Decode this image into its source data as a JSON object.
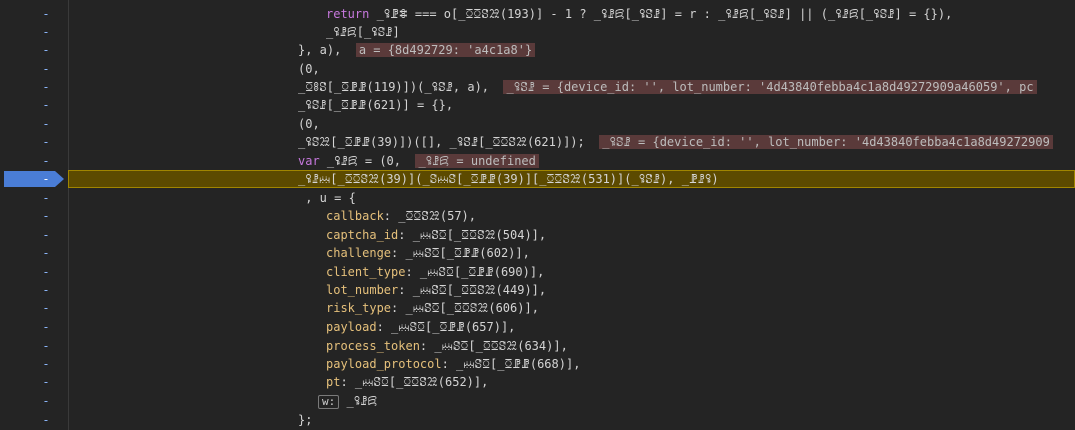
{
  "lines": [
    {
      "marker": "-",
      "code": "return _ꖤꗘꗵ === o[_ꗞꗞꗟꗠ(193)] - 1 ? _ꖤꗗꗛ[_ꖤꗟꗗ] = r : _ꖤꗗꗛ[_ꖤꗟꗗ] || (_ꖤꗗꗛ[_ꖤꗟꗗ] = {}),"
    },
    {
      "marker": "-",
      "code": "_ꖤꗗꗛ[_ꖤꗟꗗ]"
    },
    {
      "marker": "-",
      "code": "}, a),",
      "inline": "a = {8d492729: 'a4c1a8'}"
    },
    {
      "marker": "-",
      "code": "(0,"
    },
    {
      "marker": "-",
      "code": "_ꗞꗚꗟ[_ꗞꗘꗙ(119)])(_ꖤꗟꗗ, a),",
      "inline": "_ꖤꗟꗗ = {device_id: '', lot_number: '4d43840febba4c1a8d49272909a46059', pc"
    },
    {
      "marker": "-",
      "code": "_ꖤꗟꗗ[_ꗞꗘꗙ(621)] = {},"
    },
    {
      "marker": "-",
      "code": "(0,"
    },
    {
      "marker": "-",
      "code": "_ꖤꗟꗠ[_ꗞꗘꗙ(39)])([], _ꖤꗟꗗ[_ꗞꗞꗟꗠ(621)]);",
      "inline": "_ꖤꗟꗗ = {device_id: '', lot_number: '4d43840febba4c1a8d49272909"
    },
    {
      "marker": "-",
      "code": "var _ꖤꗗꗛ = (0,",
      "inline": "_ꖤꗗꗛ = undefined"
    },
    {
      "marker": "-",
      "code": "_ꖤꗗꗜ[_ꗞꗞꗟꗠ(39)](_ꗟꗜꗟ[_ꗞꗘꗙ(39)][_ꗞꗞꗟꗠ(531)](_ꖤꗟꗗ), _ꗘꗗꖤ)"
    },
    {
      "marker": "-",
      "code": " , u = {"
    },
    {
      "marker": "-",
      "prop": "callback",
      "code": ": _ꗞꗞꗟꗠ(57),"
    },
    {
      "marker": "-",
      "prop": "captcha_id",
      "code": ": _ꗜꗟꗞ[_ꗞꗞꗟꗠ(504)],"
    },
    {
      "marker": "-",
      "prop": "challenge",
      "code": ": _ꗜꗟꗞ[_ꗞꗘꗙ(602)],"
    },
    {
      "marker": "-",
      "prop": "client_type",
      "code": ": _ꗜꗟꗞ[_ꗞꗘꗙ(690)],"
    },
    {
      "marker": "-",
      "prop": "lot_number",
      "code": ": _ꗜꗟꗞ[_ꗞꗞꗟꗠ(449)],"
    },
    {
      "marker": "-",
      "prop": "risk_type",
      "code": ": _ꗜꗟꗞ[_ꗞꗞꗟꗠ(606)],"
    },
    {
      "marker": "-",
      "prop": "payload",
      "code": ": _ꗜꗟꗞ[_ꗞꗘꗙ(657)],"
    },
    {
      "marker": "-",
      "prop": "process_token",
      "code": ": _ꗜꗟꗞ[_ꗞꗞꗟꗠ(634)],"
    },
    {
      "marker": "-",
      "prop": "payload_protocol",
      "code": ": _ꗜꗟꗞ[_ꗞꗘꗙ(668)],"
    },
    {
      "marker": "-",
      "prop": "pt",
      "code": ": _ꗜꗟꗞ[_ꗞꗞꗟꗠ(652)],"
    },
    {
      "marker": "-",
      "badge": "w:",
      "code": "_ꖤꗗꗛ"
    },
    {
      "marker": "-",
      "code": "};"
    }
  ],
  "keywords": {
    "return": "return",
    "var": "var"
  },
  "colors": {
    "paused_line": "#5c4a00",
    "breakpoint": "#4a7dd6",
    "inline_value_bg": "#5a3a3a"
  }
}
